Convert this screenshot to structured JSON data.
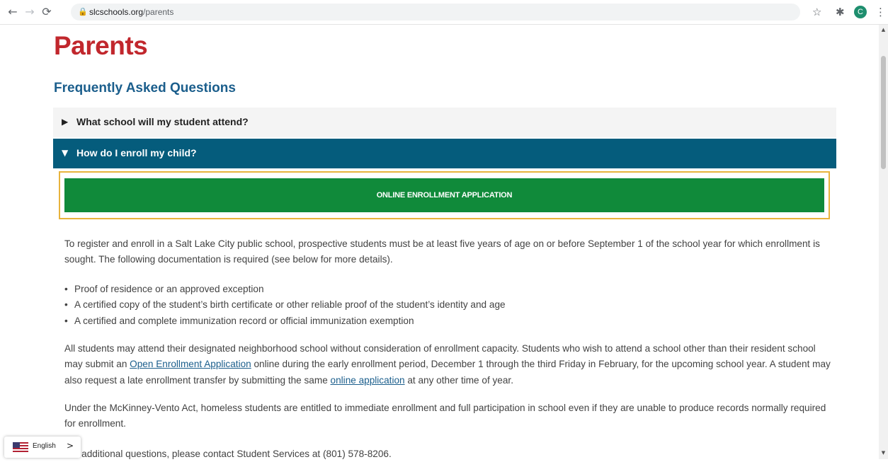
{
  "browser": {
    "back_icon": "←",
    "forward_icon": "→",
    "reload_icon": "⟳",
    "lock_icon": "🔒",
    "url_host": "slcschools.org",
    "url_path": "/parents",
    "star_icon": "☆",
    "extensions_icon": "✱",
    "profile_initial": "C",
    "menu_icon": "⋮"
  },
  "page": {
    "title": "Parents",
    "faq_heading": "Frequently Asked Questions"
  },
  "accordion": [
    {
      "question": "What school will my student attend?",
      "expanded": false,
      "arrow": "▶"
    },
    {
      "question": "How do I enroll my child?",
      "expanded": true,
      "arrow": "▼"
    }
  ],
  "enroll_button": "ONLINE ENROLLMENT APPLICATION",
  "content": {
    "p1": "To register and enroll in a Salt Lake City public school, prospective students must be at least five years of age on or before September 1 of the school year for which enrollment is sought. The following documentation is required (see below for more details).",
    "bullets": [
      "Proof of residence or an approved exception",
      "A certified copy of the student’s birth certificate or other reliable proof of the student’s identity and age",
      "A certified and complete immunization record or official immunization exemption"
    ],
    "p2_a": "All students may attend their designated neighborhood school without consideration of enrollment capacity. Students who wish to attend a school other than their resident school may submit an ",
    "p2_link1": "Open Enrollment Application",
    "p2_b": " online during the early enrollment period, December 1 through the third Friday in February, for the upcoming school year. A student may also request a late enrollment transfer by submitting the same ",
    "p2_link2": "online application",
    "p2_c": " at any other time of year.",
    "p3": "Under the McKinney-Vento Act, homeless students are entitled to immediate enrollment and full participation in school even if they are unable to produce records normally required for enrollment.",
    "p4": "For additional questions, please contact Student Services at (801) 578-8206."
  },
  "language_widget": {
    "label": "English",
    "arrow": ">"
  }
}
